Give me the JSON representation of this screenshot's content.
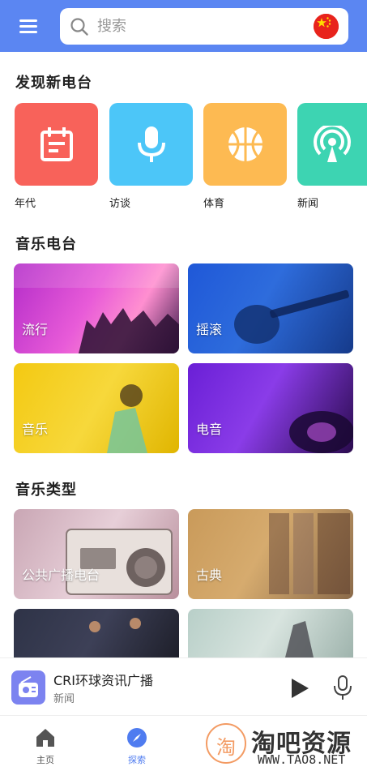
{
  "header": {
    "search_placeholder": "搜索",
    "accent": "#5b86f2"
  },
  "discover": {
    "title": "发现新电台",
    "items": [
      {
        "label": "年代",
        "color": "#f8625a",
        "icon": "calendar-icon"
      },
      {
        "label": "访谈",
        "color": "#4cc6f8",
        "icon": "microphone-icon"
      },
      {
        "label": "体育",
        "color": "#fdba52",
        "icon": "basketball-icon"
      },
      {
        "label": "新闻",
        "color": "#3dd4b2",
        "icon": "broadcast-icon"
      }
    ]
  },
  "music_radio": {
    "title": "音乐电台",
    "items": [
      {
        "label": "流行"
      },
      {
        "label": "摇滚"
      },
      {
        "label": "音乐"
      },
      {
        "label": "电音"
      }
    ]
  },
  "music_types": {
    "title": "音乐类型",
    "items": [
      {
        "label": "公共广播电台"
      },
      {
        "label": "古典"
      }
    ]
  },
  "player": {
    "title": "CRI环球资讯广播",
    "subtitle": "新闻"
  },
  "nav": {
    "items": [
      {
        "label": "主页",
        "icon": "home-icon"
      },
      {
        "label": "探索",
        "icon": "compass-icon"
      }
    ]
  },
  "watermark": {
    "logo_char": "淘",
    "title": "淘吧资源",
    "url": "WWW.TAO8.NET"
  }
}
